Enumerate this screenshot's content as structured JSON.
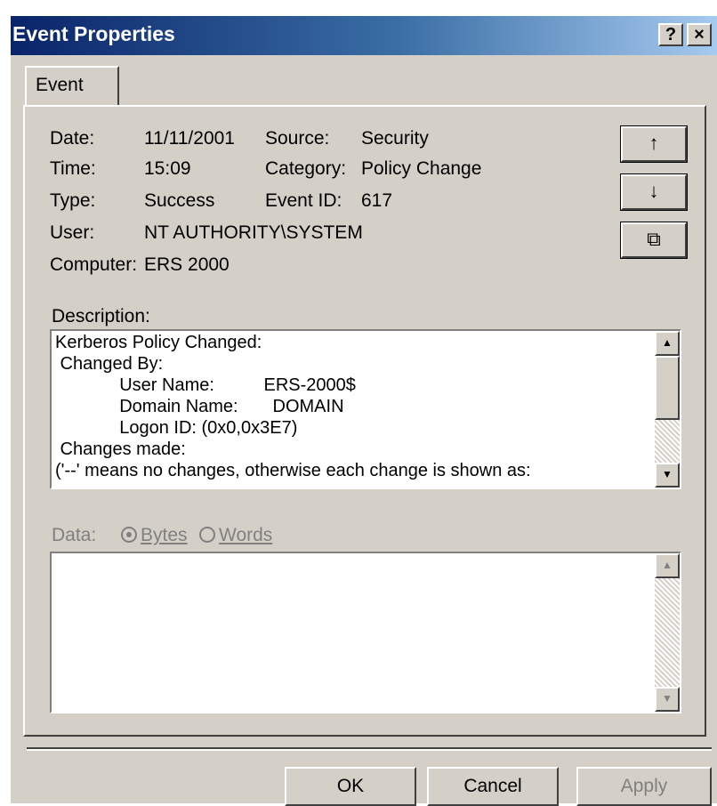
{
  "window": {
    "title": "Event Properties",
    "help_glyph": "?",
    "close_glyph": "×"
  },
  "tabs": [
    {
      "label": "Event"
    }
  ],
  "fields": {
    "date_label": "Date:",
    "date_value": "11/11/2001",
    "source_label": "Source:",
    "source_value": "Security",
    "time_label": "Time:",
    "time_value": "15:09",
    "category_label": "Category:",
    "category_value": "Policy Change",
    "type_label": "Type:",
    "type_value": "Success",
    "eventid_label": "Event ID:",
    "eventid_value": "617",
    "user_label": "User:",
    "user_value": "NT AUTHORITY\\SYSTEM",
    "computer_label": "Computer:",
    "computer_value": "ERS 2000"
  },
  "nav_buttons": {
    "up_glyph": "↑",
    "down_glyph": "↓",
    "copy_glyph": "⧉"
  },
  "description": {
    "label": "Description:",
    "lines": [
      "Kerberos Policy Changed:",
      " Changed By:",
      "             User Name:          ERS-2000$",
      "             Domain Name:       DOMAIN",
      "             Logon ID: (0x0,0x3E7)",
      " Changes made:",
      "('--' means no changes, otherwise each change is shown as:"
    ]
  },
  "data_section": {
    "label": "Data:",
    "bytes_label": "Bytes",
    "words_label": "Words"
  },
  "scroll_glyphs": {
    "up": "▲",
    "down": "▼"
  },
  "buttons": {
    "ok": "OK",
    "cancel": "Cancel",
    "apply": "Apply"
  }
}
